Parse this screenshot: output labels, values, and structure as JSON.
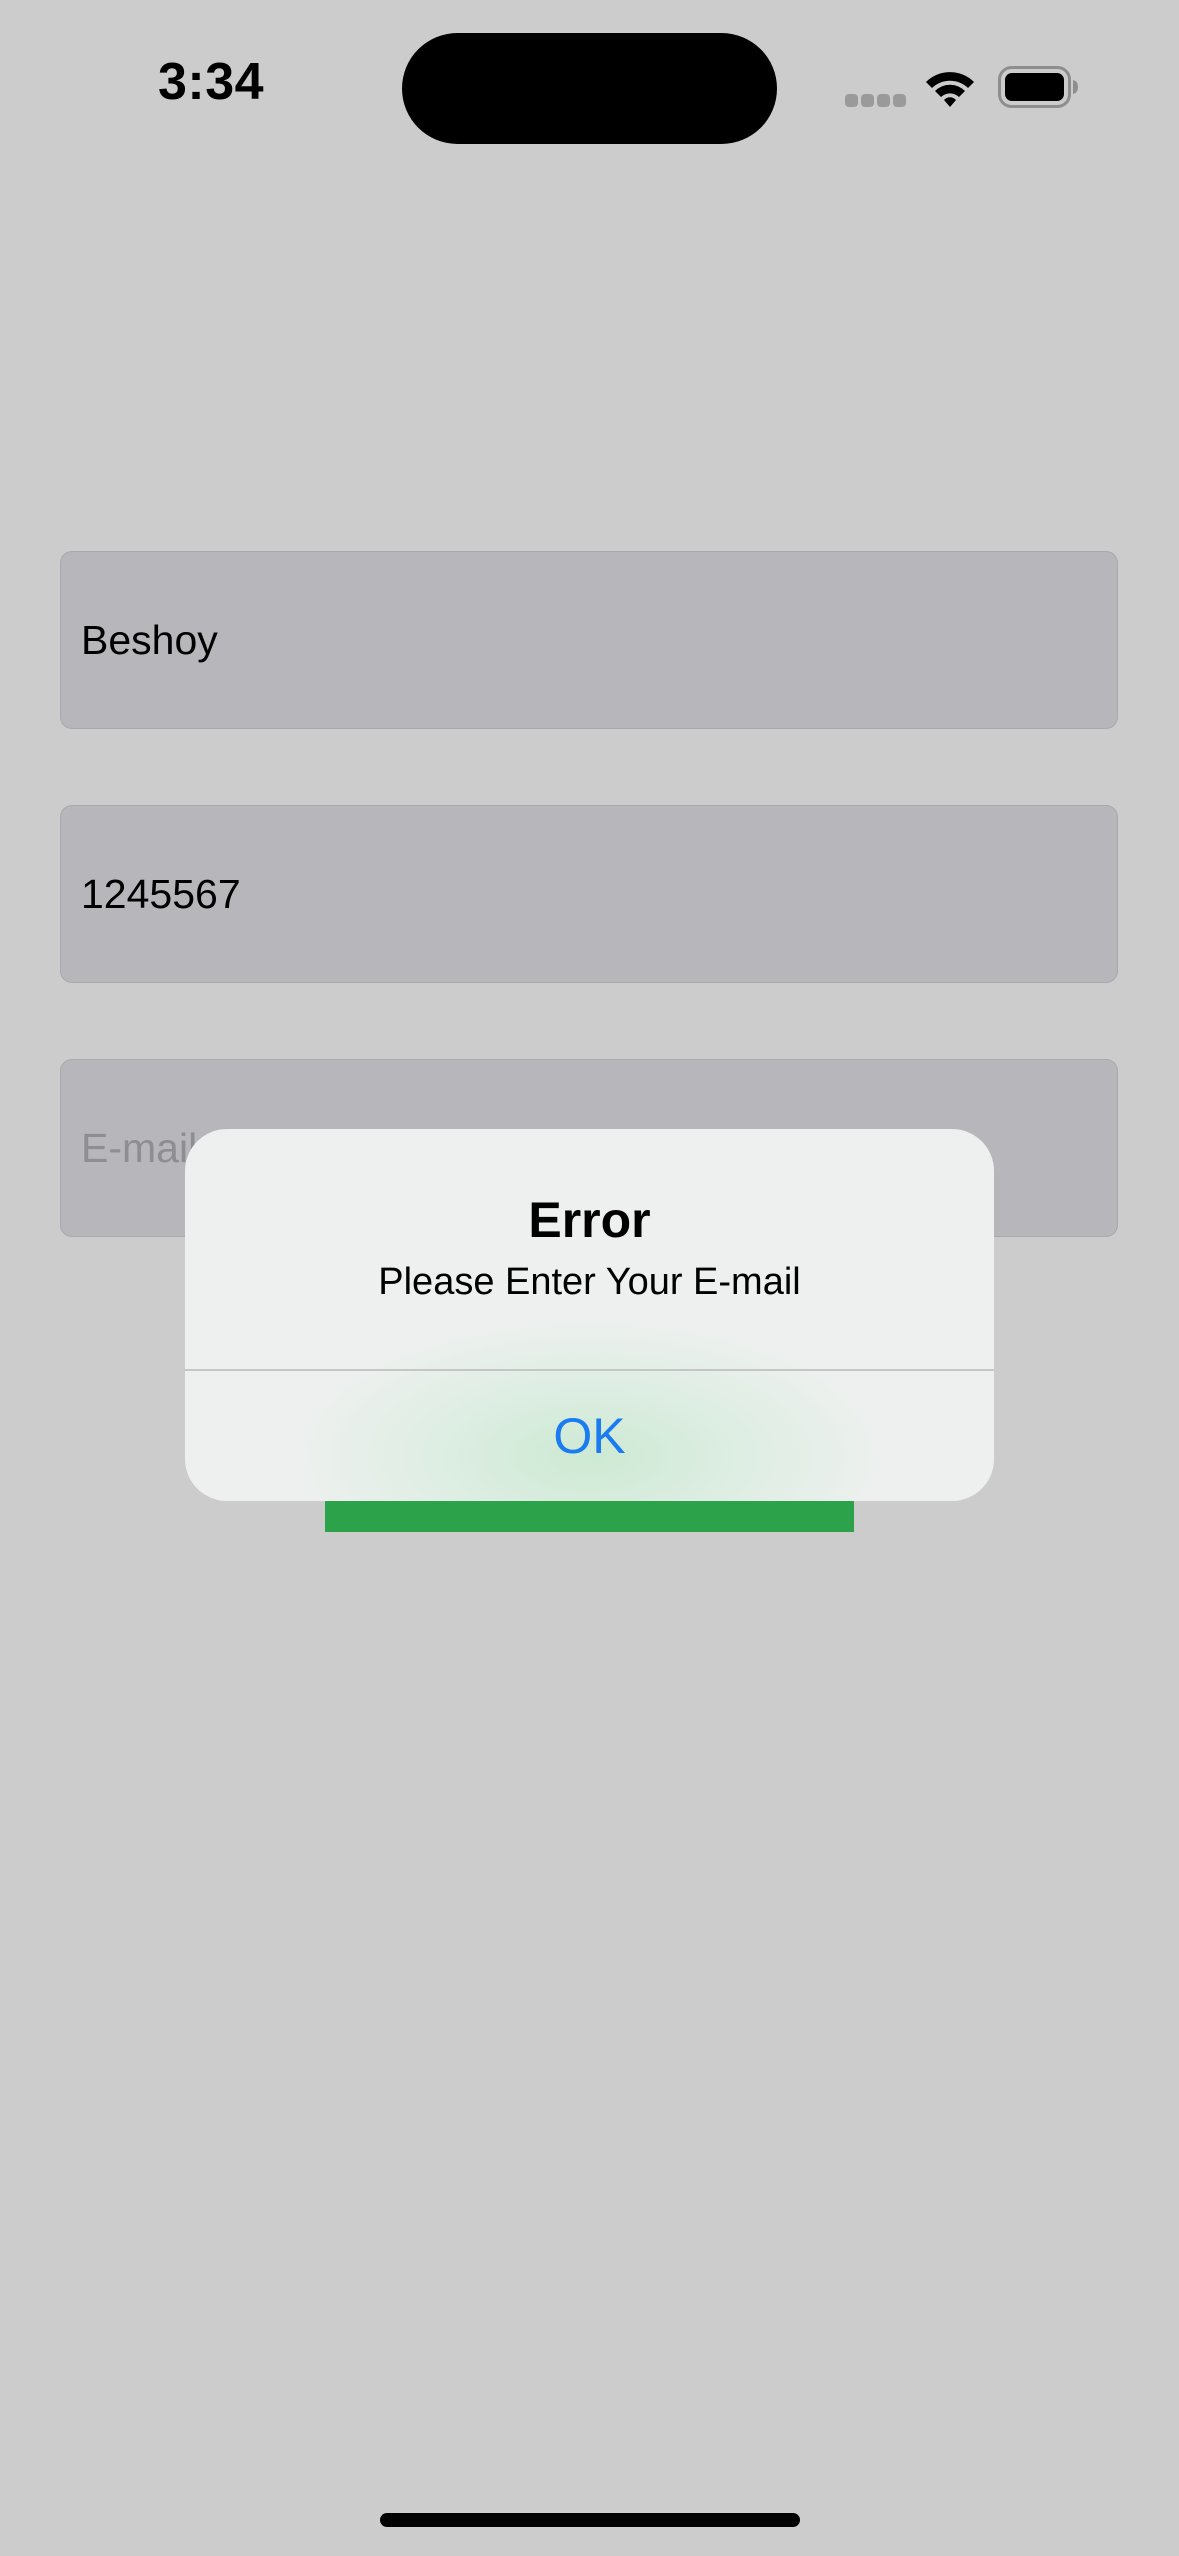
{
  "status_bar": {
    "time": "3:34",
    "icons": [
      "signal-icon",
      "wifi-icon",
      "battery-icon"
    ]
  },
  "form": {
    "name_field": {
      "value": "Beshoy",
      "placeholder": ""
    },
    "phone_field": {
      "value": "1245567",
      "placeholder": ""
    },
    "email_field": {
      "value": "",
      "placeholder": "E-mail"
    },
    "submit_button": {
      "label": "",
      "color": "#2ca24a"
    }
  },
  "alert": {
    "title": "Error",
    "message": "Please Enter Your E-mail",
    "ok_label": "OK",
    "ok_color": "#1a7cf0"
  }
}
